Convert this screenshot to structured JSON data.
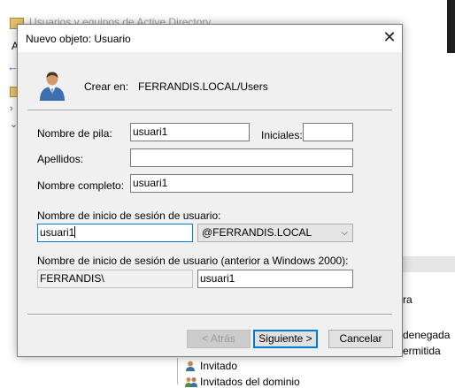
{
  "background": {
    "window_title": "Usuarios y equipos de Active Directory",
    "menu_letter": "A",
    "list_fragments": [
      {
        "text": "ra"
      },
      {
        "text": "denegada"
      },
      {
        "text": "ermitida"
      }
    ],
    "list_items": [
      {
        "label": "Invitado",
        "icon": "user-icon"
      },
      {
        "label": "Invitados del dominio",
        "icon": "group-icon"
      }
    ]
  },
  "dialog": {
    "title": "Nuevo objeto: Usuario",
    "close_glyph": "✕",
    "create_in_label": "Crear en:",
    "create_in_value": "FERRANDIS.LOCAL/Users",
    "fields": {
      "first_name": {
        "label": "Nombre de pila:",
        "value": "usuari1"
      },
      "initials": {
        "label": "Iniciales:",
        "value": ""
      },
      "last_name": {
        "label": "Apellidos:",
        "value": ""
      },
      "full_name": {
        "label": "Nombre completo:",
        "value": "usuari1"
      },
      "logon_name": {
        "label": "Nombre de inicio de sesión de usuario:",
        "value": "usuari1"
      },
      "upn_suffix": {
        "value": "@FERRANDIS.LOCAL"
      },
      "pre2000": {
        "label": "Nombre de inicio de sesión de usuario (anterior a Windows 2000):",
        "domain": "FERRANDIS\\",
        "value": "usuari1"
      }
    },
    "buttons": {
      "back": "< Atrás",
      "next": "Siguiente >",
      "cancel": "Cancelar"
    }
  },
  "colors": {
    "accent": "#0078d7",
    "dialog_bg": "#f0f0f0"
  }
}
